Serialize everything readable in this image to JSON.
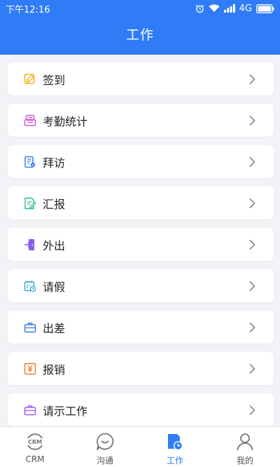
{
  "status_bar": {
    "time": "下午12:16",
    "network": "4G",
    "icons": [
      "alarm-icon",
      "wifi-icon",
      "signal-icon",
      "battery-icon"
    ]
  },
  "header": {
    "title": "工作"
  },
  "menu": {
    "items": [
      {
        "label": "签到",
        "icon": "sign-in-icon",
        "color": "#f2b01e"
      },
      {
        "label": "考勤统计",
        "icon": "attendance-stats-icon",
        "color": "#d65ad8"
      },
      {
        "label": "拜访",
        "icon": "visit-icon",
        "color": "#3b7ef0"
      },
      {
        "label": "汇报",
        "icon": "report-icon",
        "color": "#2bbf8f"
      },
      {
        "label": "外出",
        "icon": "go-out-icon",
        "color": "#8a5cf0"
      },
      {
        "label": "请假",
        "icon": "leave-icon",
        "color": "#2aa6d8"
      },
      {
        "label": "出差",
        "icon": "business-trip-icon",
        "color": "#3b7ef0"
      },
      {
        "label": "报销",
        "icon": "reimbursement-icon",
        "color": "#f07a2b"
      },
      {
        "label": "请示工作",
        "icon": "request-instruction-icon",
        "color": "#a35cf0"
      }
    ]
  },
  "tabbar": {
    "tabs": [
      {
        "label": "CRM",
        "icon": "crm-icon",
        "active": false
      },
      {
        "label": "沟通",
        "icon": "chat-icon",
        "active": false
      },
      {
        "label": "工作",
        "icon": "work-icon",
        "active": true
      },
      {
        "label": "我的",
        "icon": "profile-icon",
        "active": false
      }
    ]
  },
  "colors": {
    "accent": "#2f7cf6",
    "background": "#f2f3f7"
  }
}
